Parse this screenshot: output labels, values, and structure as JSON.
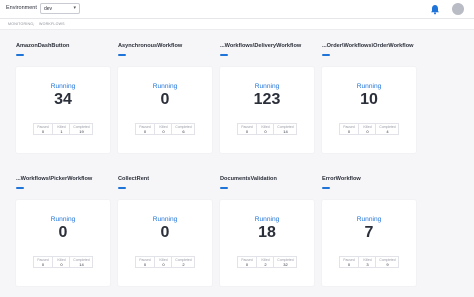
{
  "header": {
    "env_label": "Environment",
    "env_value": "dev",
    "accent": "#1f74d9"
  },
  "breadcrumb": [
    "MONITORING",
    "WORKFLOWS"
  ],
  "stat_labels": {
    "paused": "Paused",
    "killed": "Killed",
    "completed": "Completed"
  },
  "workflows": [
    {
      "name": "AmazonDashButton",
      "state": "Running",
      "count": "34",
      "paused": "0",
      "killed": "1",
      "completed": "19"
    },
    {
      "name": "AsynchronousWorkflow",
      "state": "Running",
      "count": "0",
      "paused": "0",
      "killed": "0",
      "completed": "6"
    },
    {
      "name": "...Workflows\\DeliveryWorkflow",
      "state": "Running",
      "count": "123",
      "paused": "0",
      "killed": "0",
      "completed": "14"
    },
    {
      "name": "...Order\\Workflows\\OrderWorkflow",
      "state": "Running",
      "count": "10",
      "paused": "0",
      "killed": "0",
      "completed": "4"
    },
    {
      "name": "...Workflows\\PickerWorkflow",
      "state": "Running",
      "count": "0",
      "paused": "0",
      "killed": "0",
      "completed": "14"
    },
    {
      "name": "CollectRent",
      "state": "Running",
      "count": "0",
      "paused": "0",
      "killed": "0",
      "completed": "2"
    },
    {
      "name": "DocumentsValidation",
      "state": "Running",
      "count": "18",
      "paused": "0",
      "killed": "2",
      "completed": "32"
    },
    {
      "name": "ErrorWorkflow",
      "state": "Running",
      "count": "7",
      "paused": "0",
      "killed": "3",
      "completed": "9"
    }
  ]
}
